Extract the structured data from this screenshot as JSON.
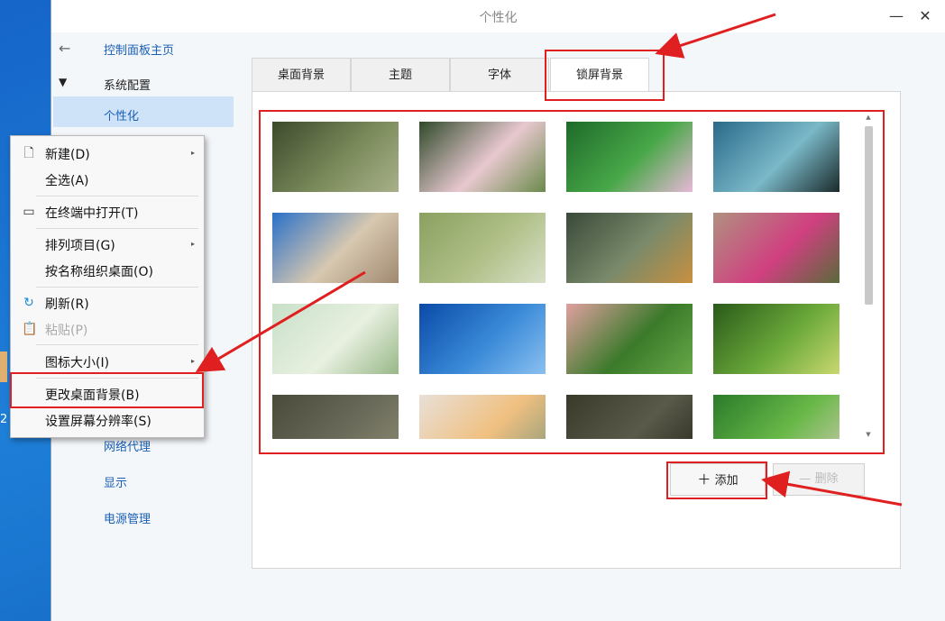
{
  "window": {
    "title": "个性化",
    "minimize": "—",
    "close": "✕"
  },
  "sidebar": {
    "back_icon": "←",
    "home_label": "控制面板主页",
    "section_arrow": "▼",
    "section_label": "系统配置",
    "selected_label": "个性化",
    "items": [
      "网络代理",
      "显示",
      "电源管理"
    ]
  },
  "tabs": [
    "桌面背景",
    "主题",
    "字体",
    "锁屏背景"
  ],
  "active_tab": "锁屏背景",
  "thumbnails": [
    {
      "name": "mossy-roof",
      "colors": [
        "#3c4a2c",
        "#7a8a5a",
        "#a8b08a"
      ]
    },
    {
      "name": "pink-flowers",
      "colors": [
        "#2f4a2a",
        "#e8c8d0",
        "#6a8a4a"
      ]
    },
    {
      "name": "green-stems-flower",
      "colors": [
        "#1e6a2a",
        "#48a848",
        "#e8b8d8"
      ]
    },
    {
      "name": "ferris-wheel",
      "colors": [
        "#2a6a8a",
        "#7ab8c8",
        "#1a2a2a"
      ]
    },
    {
      "name": "desert-sky",
      "colors": [
        "#2a70c8",
        "#d8c8b0",
        "#a08870"
      ]
    },
    {
      "name": "grass-field",
      "colors": [
        "#8aa060",
        "#b0c088",
        "#d8e0c8"
      ]
    },
    {
      "name": "kingfisher",
      "colors": [
        "#3a4a3a",
        "#7a8a6a",
        "#c89040"
      ]
    },
    {
      "name": "pink-roses",
      "colors": [
        "#b09080",
        "#d04080",
        "#5a6a3a"
      ]
    },
    {
      "name": "pale-flowers",
      "colors": [
        "#c8e0c8",
        "#e8f0e0",
        "#98b888"
      ]
    },
    {
      "name": "blue-sky",
      "colors": [
        "#0a4aa8",
        "#3a8ad8",
        "#8ac0f0"
      ]
    },
    {
      "name": "sunset-meadow",
      "colors": [
        "#e0a0a0",
        "#3a7a2a",
        "#68a848"
      ]
    },
    {
      "name": "moss-closeup",
      "colors": [
        "#2a5a1a",
        "#6aa83a",
        "#c8d870"
      ]
    },
    {
      "name": "stone-path",
      "colors": [
        "#4a4a3a",
        "#6a6a5a",
        "#8a8a70"
      ]
    },
    {
      "name": "peach-rose",
      "colors": [
        "#e8e0d8",
        "#f0c080",
        "#8a9a7a"
      ]
    },
    {
      "name": "forest-roots",
      "colors": [
        "#3a3a2a",
        "#5a5a4a",
        "#2a2a20"
      ]
    },
    {
      "name": "forest-path",
      "colors": [
        "#2a7a2a",
        "#68b848",
        "#c8c8a8"
      ]
    }
  ],
  "buttons": {
    "add_icon": "＋",
    "add_label": "添加",
    "delete_icon": "—",
    "delete_label": "删除"
  },
  "context_menu": {
    "items": [
      {
        "label": "新建(D)",
        "icon": "new-icon",
        "glyph": "🗋",
        "submenu": true,
        "disabled": false
      },
      {
        "label": "全选(A)",
        "icon": "",
        "glyph": "",
        "submenu": false,
        "disabled": false
      },
      {
        "label": "在终端中打开(T)",
        "icon": "terminal-icon",
        "glyph": "▭",
        "submenu": false,
        "disabled": false
      },
      {
        "label": "排列项目(G)",
        "icon": "",
        "glyph": "",
        "submenu": true,
        "disabled": false
      },
      {
        "label": "按名称组织桌面(O)",
        "icon": "",
        "glyph": "",
        "submenu": false,
        "disabled": false
      },
      {
        "label": "刷新(R)",
        "icon": "refresh-icon",
        "glyph": "↻",
        "submenu": false,
        "disabled": false
      },
      {
        "label": "粘贴(P)",
        "icon": "paste-icon",
        "glyph": "📋",
        "submenu": false,
        "disabled": true
      },
      {
        "label": "图标大小(I)",
        "icon": "",
        "glyph": "",
        "submenu": true,
        "disabled": false
      },
      {
        "label": "更改桌面背景(B)",
        "icon": "",
        "glyph": "",
        "submenu": false,
        "disabled": false
      },
      {
        "label": "设置屏幕分辨率(S)",
        "icon": "",
        "glyph": "",
        "submenu": false,
        "disabled": false
      }
    ],
    "submenu_glyph": "▸"
  },
  "desktop": {
    "partial_text": "2"
  },
  "colors": {
    "accent": "#1a5fb4",
    "highlight_red": "#e02020",
    "selected_bg": "#cfe3f8"
  }
}
